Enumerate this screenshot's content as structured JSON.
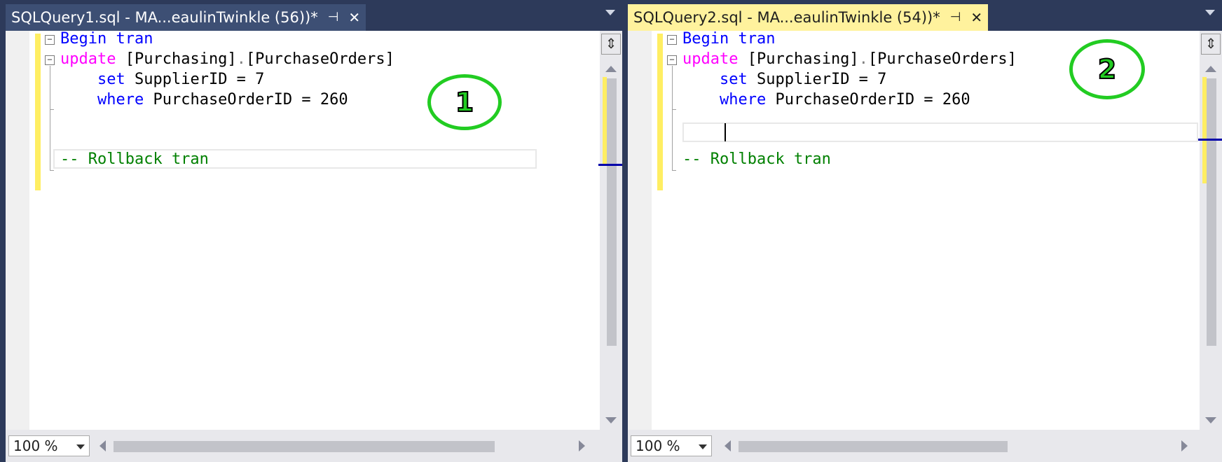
{
  "panes": [
    {
      "tab": {
        "title": "SQLQuery1.sql - MA...eaulinTwinkle (56))*",
        "active": false,
        "pin_icon": "pin-icon",
        "close_icon": "close-icon"
      },
      "code": {
        "line1": {
          "kw": "Begin",
          "rest": "tran"
        },
        "line2": {
          "kw": "update",
          "obj1": "[Purchasing]",
          "dot": ".",
          "obj2": "[PurchaseOrders]"
        },
        "line3": {
          "kw": "set",
          "rest": "SupplierID = 7"
        },
        "line4": {
          "kw": "where",
          "rest": "PurchaseOrderID = 260"
        },
        "comment": "-- Rollback tran"
      },
      "badge": "1",
      "zoom": "100 %"
    },
    {
      "tab": {
        "title": "SQLQuery2.sql - MA...eaulinTwinkle (54))*",
        "active": true,
        "pin_icon": "pin-icon",
        "close_icon": "close-icon"
      },
      "code": {
        "line1": {
          "kw": "Begin",
          "rest": "tran"
        },
        "line2": {
          "kw": "update",
          "obj1": "[Purchasing]",
          "dot": ".",
          "obj2": "[PurchaseOrders]"
        },
        "line3": {
          "kw": "set",
          "rest": "SupplierID = 7"
        },
        "line4": {
          "kw": "where",
          "rest": "PurchaseOrderID = 260"
        },
        "comment": "-- Rollback tran"
      },
      "badge": "2",
      "zoom": "100 %"
    }
  ],
  "colors": {
    "keyword": "#0000ff",
    "dml_keyword": "#ff00ff",
    "comment": "#008000",
    "badge": "#22cc22",
    "active_tab": "#fff29d",
    "change_marker": "#ffee62"
  }
}
